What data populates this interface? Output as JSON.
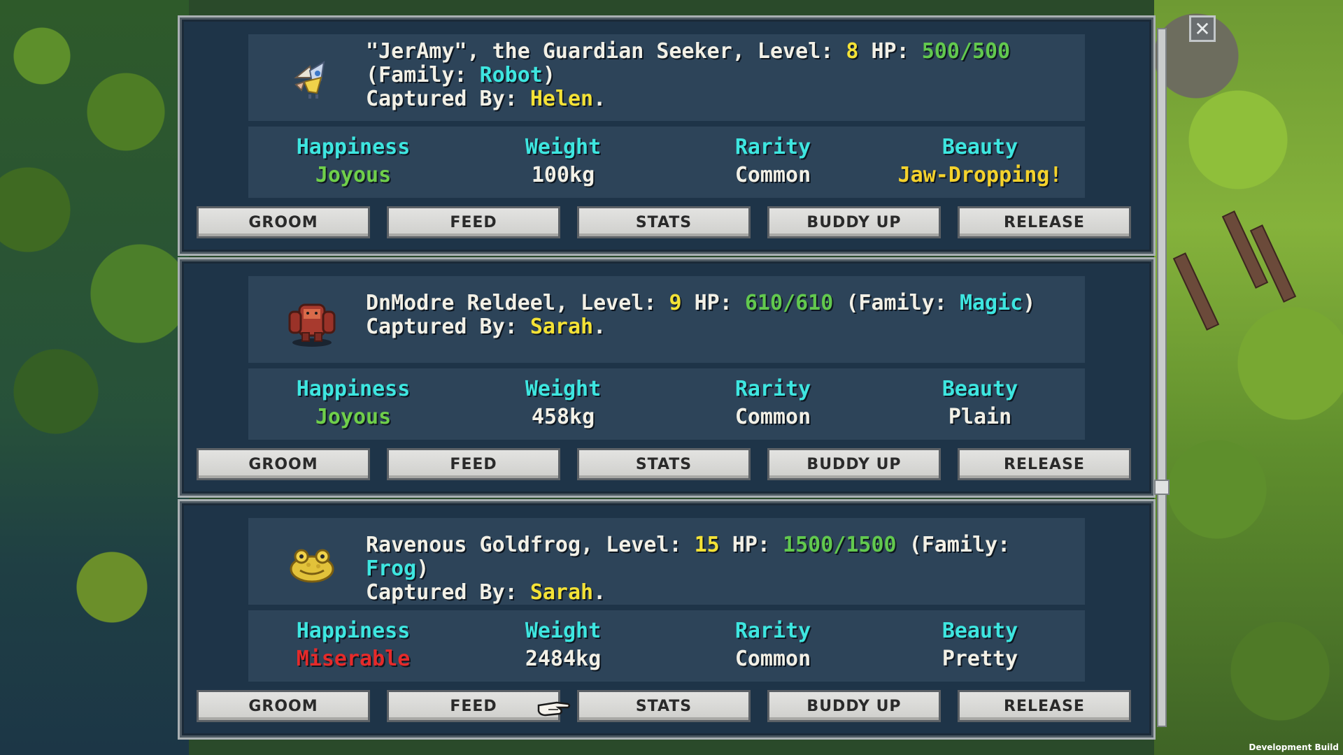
{
  "close_button": {
    "icon": "close-icon",
    "glyph": "✕"
  },
  "footer": {
    "dev_build": "Development Build"
  },
  "labels": {
    "happiness": "Happiness",
    "weight": "Weight",
    "rarity": "Rarity",
    "beauty": "Beauty",
    "captured_by": "Captured By: ",
    "level": ", Level: ",
    "hp": " HP: ",
    "family_open": " (Family: ",
    "family_close": ")"
  },
  "buttons": {
    "groom": "GROOM",
    "feed": "FEED",
    "stats": "STATS",
    "buddy_up": "BUDDY UP",
    "release": "RELEASE"
  },
  "pets": [
    {
      "name": "\"JerAmy\", the Guardian Seeker",
      "level": "8",
      "hp": "500/500",
      "family": "Robot",
      "captured_by": "Helen",
      "happiness": "Joyous",
      "weight": "100kg",
      "rarity": "Common",
      "beauty": "Jaw-Dropping!",
      "portrait_icon": "robot-bird-icon"
    },
    {
      "name": "DnModre Reldeel",
      "level": "9",
      "hp": "610/610",
      "family": "Magic",
      "captured_by": "Sarah",
      "happiness": "Joyous",
      "weight": "458kg",
      "rarity": "Common",
      "beauty": "Plain",
      "portrait_icon": "red-golem-icon"
    },
    {
      "name": "Ravenous Goldfrog",
      "level": "15",
      "hp": "1500/1500",
      "family": "Frog",
      "captured_by": "Sarah",
      "happiness": "Miserable",
      "weight": "2484kg",
      "rarity": "Common",
      "beauty": "Pretty",
      "portrait_icon": "gold-frog-icon"
    }
  ],
  "colors": {
    "panel_bg": "#1e3448",
    "box_bg": "#2d4459",
    "accent_yellow": "#f4e236",
    "accent_green": "#62c94e",
    "accent_cyan": "#3ee6e0",
    "miserable_red": "#e52a2a"
  }
}
